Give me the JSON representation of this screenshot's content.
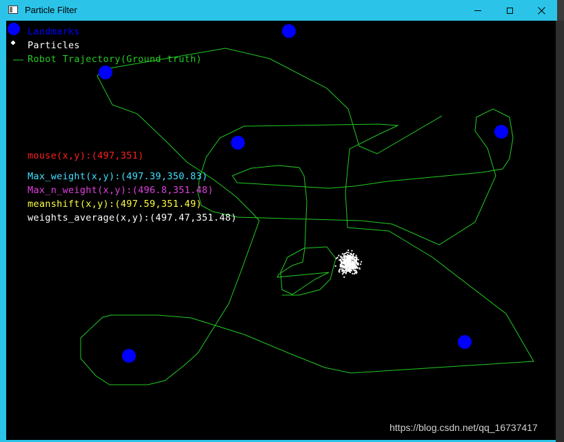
{
  "window": {
    "title": "Particle Filter",
    "titlebar_color": "#2bc4e8"
  },
  "legend": {
    "landmarks": "Landmarks",
    "particles": "Particles",
    "trajectory": "Robot Trajectory(Ground truth)",
    "landmark_color": "#0000ff",
    "particle_color": "#ffffff",
    "trajectory_color": "#00dd00"
  },
  "readouts": {
    "mouse": "mouse(x,y):(497,351)",
    "max_weight": "Max_weight(x,y):(497.39,350.83)",
    "max_n_weight": "Max_n_weight(x,y):(496.8,351.48)",
    "meanshift": "meanshift(x,y):(497.59,351.49)",
    "weights_average": "weights_average(x,y):(497.47,351.48)",
    "mouse_color": "#ff2020",
    "max_weight_color": "#40e0ff",
    "max_n_weight_color": "#e040e0",
    "meanshift_color": "#ffff40",
    "weights_average_color": "#ffffff"
  },
  "watermark": "https://blog.csdn.net/qq_16737417"
}
